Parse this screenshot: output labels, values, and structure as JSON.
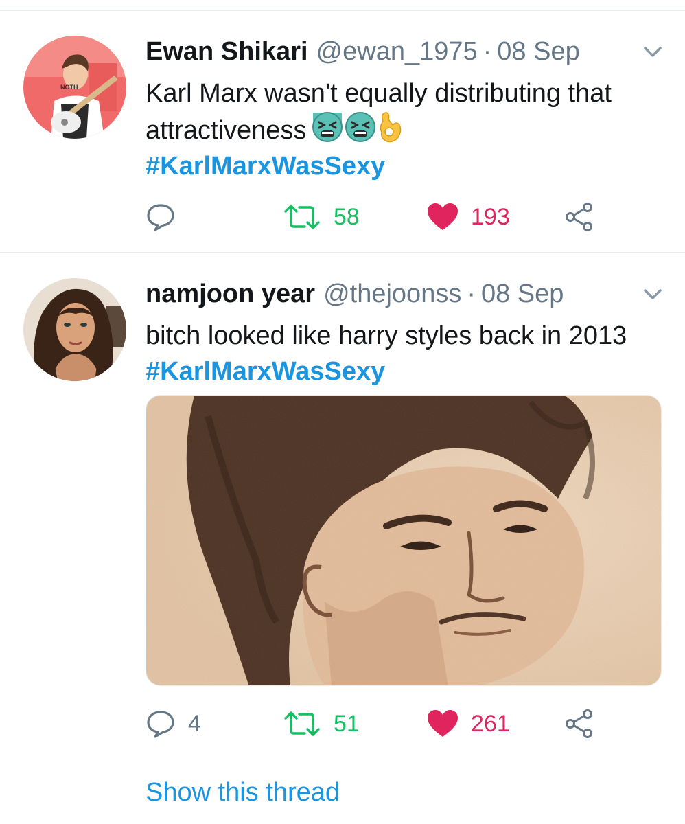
{
  "tweets": [
    {
      "author_name": "Ewan Shikari",
      "handle": "@ewan_1975",
      "separator": "·",
      "date": "08 Sep",
      "text": "Karl Marx wasn't equally distributing that attractiveness",
      "emojis": [
        "tired-face-emoji",
        "tired-face-emoji",
        "ok-hand-emoji"
      ],
      "hashtag": "#KarlMarxWasSexy",
      "reply_count": "",
      "retweet_count": "58",
      "like_count": "193",
      "avatar_icon": "avatar-guitarist"
    },
    {
      "author_name": "namjoon year",
      "handle": "@thejoonss",
      "separator": "·",
      "date": "08 Sep",
      "text": "bitch looked like harry styles back in 2013",
      "hashtag": "#KarlMarxWasSexy",
      "media": "karl-marx-portrait-engraving",
      "reply_count": "4",
      "retweet_count": "51",
      "like_count": "261",
      "avatar_icon": "avatar-woman-curly-hair"
    }
  ],
  "show_thread_label": "Show this thread",
  "colors": {
    "link": "#1b95e0",
    "retweet": "#17bf63",
    "like": "#e0245e",
    "muted": "#657786",
    "divider": "#e6ecf0"
  }
}
